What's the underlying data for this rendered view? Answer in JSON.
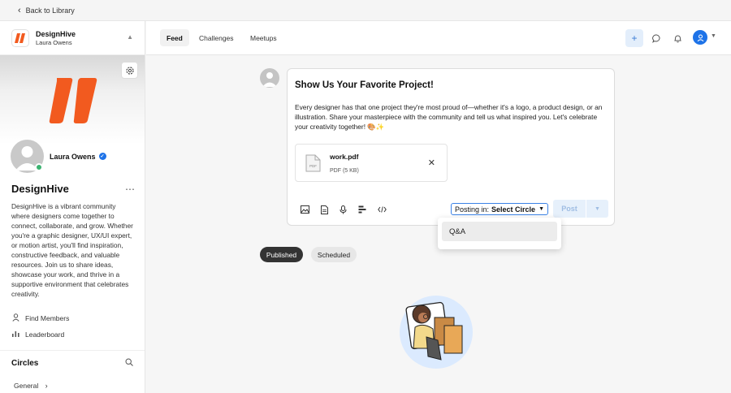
{
  "back_bar": {
    "label": "Back to Library"
  },
  "sidebar": {
    "brand": {
      "name": "DesignHive",
      "user": "Laura Owens"
    },
    "profile": {
      "name": "Laura Owens"
    },
    "community": {
      "title": "DesignHive",
      "description": "DesignHive is a vibrant community where designers come together to connect, collaborate, and grow. Whether you're a graphic designer, UX/UI expert, or motion artist, you'll find inspiration, constructive feedback, and valuable resources. Join us to share ideas, showcase your work, and thrive in a supportive environment that celebrates creativity."
    },
    "links": [
      {
        "label": "Find Members",
        "icon": "person-icon"
      },
      {
        "label": "Leaderboard",
        "icon": "bar-chart-icon"
      }
    ],
    "circles": {
      "title": "Circles",
      "items": [
        {
          "label": "General"
        }
      ]
    }
  },
  "header": {
    "tabs": [
      {
        "label": "Feed",
        "active": true
      },
      {
        "label": "Challenges",
        "active": false
      },
      {
        "label": "Meetups",
        "active": false
      }
    ]
  },
  "composer": {
    "title": "Show Us Your Favorite Project!",
    "body": "Every designer has that one project they're most proud of—whether it's a logo, a product design, or an illustration. Share your masterpiece with the community and tell us what inspired you. Let's celebrate your creativity together! 🎨✨",
    "attachment": {
      "name": "work.pdf",
      "meta": "PDF (5 KB)",
      "icon_label": "PDF"
    },
    "posting_in": {
      "prefix": "Posting in:",
      "value": "Select Circle"
    },
    "post_label": "Post",
    "dropdown_options": [
      "Q&A"
    ]
  },
  "filters": {
    "published": "Published",
    "scheduled": "Scheduled"
  },
  "colors": {
    "brand_orange": "#f25a1f",
    "accent_blue": "#1e73e8",
    "online_green": "#3cb371"
  }
}
